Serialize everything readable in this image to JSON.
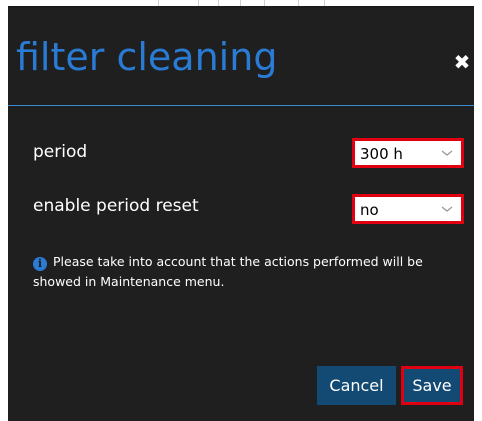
{
  "dialog": {
    "title": "filter cleaning",
    "close_icon": "close-icon"
  },
  "fields": [
    {
      "label": "period",
      "value": "300 h"
    },
    {
      "label": "enable period reset",
      "value": "no"
    }
  ],
  "info": {
    "icon": "info-icon",
    "icon_glyph": "i",
    "text": "Please take into account that the actions performed will be showed in Maintenance menu."
  },
  "buttons": {
    "cancel": "Cancel",
    "save": "Save"
  },
  "colors": {
    "background": "#1f1f1f",
    "title": "#2a7bd4",
    "highlight": "#e00012",
    "button": "#134a73"
  }
}
